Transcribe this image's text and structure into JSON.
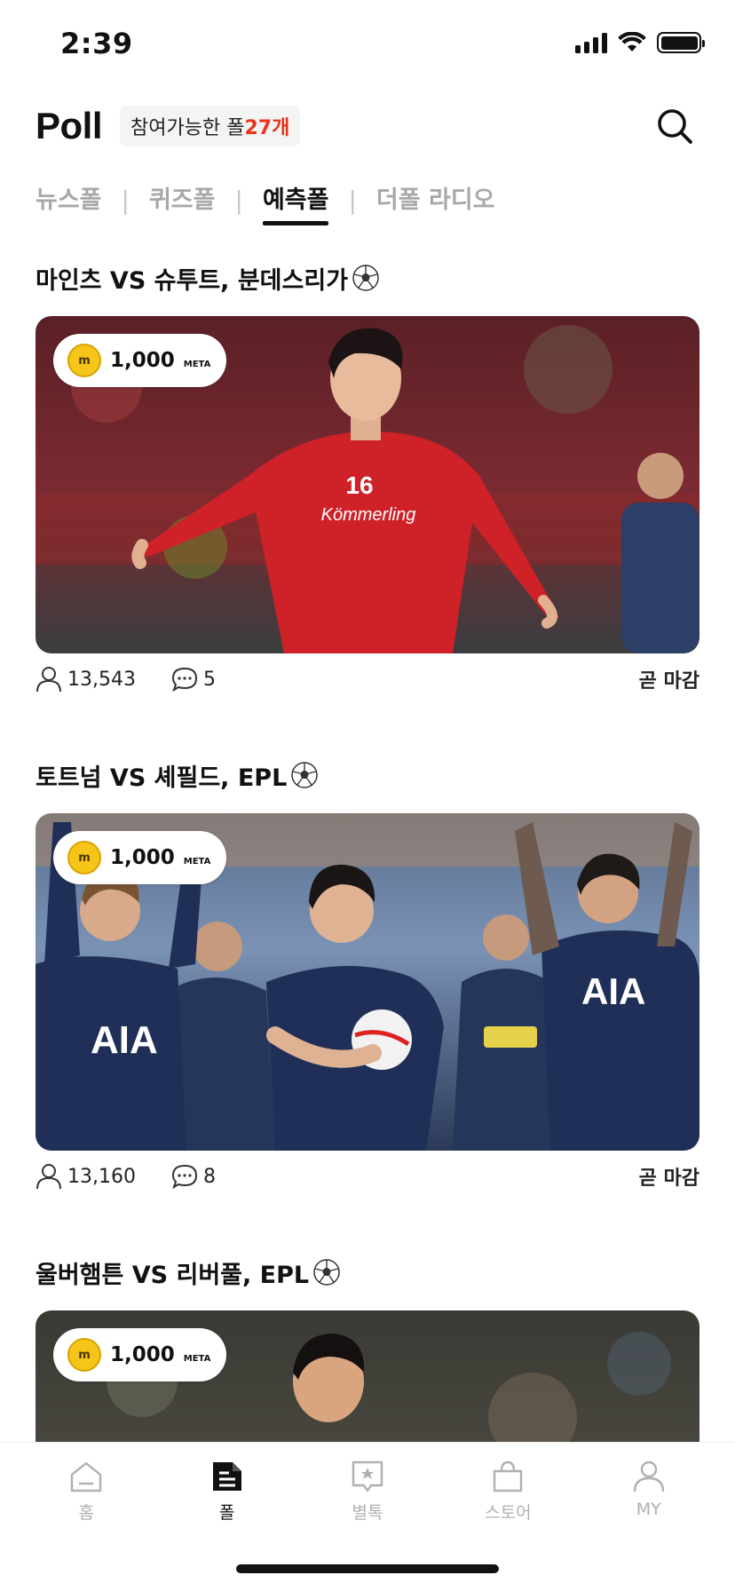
{
  "status": {
    "time": "2:39"
  },
  "header": {
    "title": "Poll",
    "available_label": "참여가능한 폴 ",
    "available_count": "27개"
  },
  "tabs": [
    {
      "label": "뉴스폴",
      "active": false
    },
    {
      "label": "퀴즈폴",
      "active": false
    },
    {
      "label": "예측폴",
      "active": true
    },
    {
      "label": "더폴 라디오",
      "active": false
    }
  ],
  "polls": [
    {
      "title": "마인츠 VS 슈투트, 분데스리가",
      "reward_amount": "1,000",
      "reward_unit": "META",
      "participants": "13,543",
      "comments": "5",
      "deadline": "곧 마감",
      "photo_text": "Kömmerling"
    },
    {
      "title": "토트넘 VS 셰필드, EPL",
      "reward_amount": "1,000",
      "reward_unit": "META",
      "participants": "13,160",
      "comments": "8",
      "deadline": "곧 마감",
      "photo_text": "AIA"
    },
    {
      "title": "울버햄튼 VS 리버풀, EPL",
      "reward_amount": "1,000",
      "reward_unit": "META",
      "participants": "",
      "comments": "",
      "deadline": "",
      "photo_text": ""
    }
  ],
  "bottom_nav": [
    {
      "label": "홈",
      "icon": "home-icon",
      "active": false
    },
    {
      "label": "폴",
      "icon": "document-icon",
      "active": true
    },
    {
      "label": "별톡",
      "icon": "star-chat-icon",
      "active": false
    },
    {
      "label": "스토어",
      "icon": "shopping-bag-icon",
      "active": false
    },
    {
      "label": "MY",
      "icon": "user-icon",
      "active": false
    }
  ],
  "colors": {
    "accent_red": "#e8341c",
    "coin_yellow": "#f6c51a",
    "inactive_gray": "#a8a8a8"
  }
}
